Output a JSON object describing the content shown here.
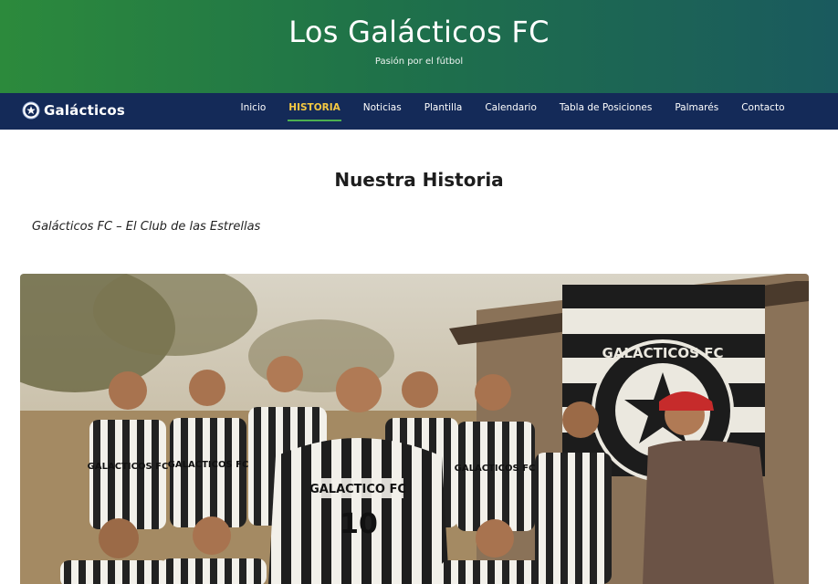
{
  "hero": {
    "title": "Los Galácticos FC",
    "subtitle": "Pasión por el fútbol"
  },
  "nav": {
    "brand": "Galácticos",
    "brand_icon": "soccer-ball-star-icon",
    "items": [
      {
        "label": "Inicio",
        "active": false
      },
      {
        "label": "HISTORIA",
        "active": true
      },
      {
        "label": "Noticias",
        "active": false
      },
      {
        "label": "Plantilla",
        "active": false
      },
      {
        "label": "Calendario",
        "active": false
      },
      {
        "label": "Tabla de Posiciones",
        "active": false
      },
      {
        "label": "Palmarés",
        "active": false
      },
      {
        "label": "Contacto",
        "active": false
      }
    ]
  },
  "main": {
    "heading": "Nuestra Historia",
    "tagline": "Galácticos FC – El Club de las Estrellas"
  },
  "photo": {
    "flag_text": "GALACTICOS FC",
    "shirt_text": "GALACTICOS FC",
    "captain_shirt_text": "GALACTICO FC",
    "captain_number": "10"
  },
  "colors": {
    "hero_start": "#2c8a3c",
    "hero_end": "#1a5a5e",
    "nav_bg": "#142a58",
    "active_text": "#f5c842",
    "active_underline": "#4caf50"
  }
}
